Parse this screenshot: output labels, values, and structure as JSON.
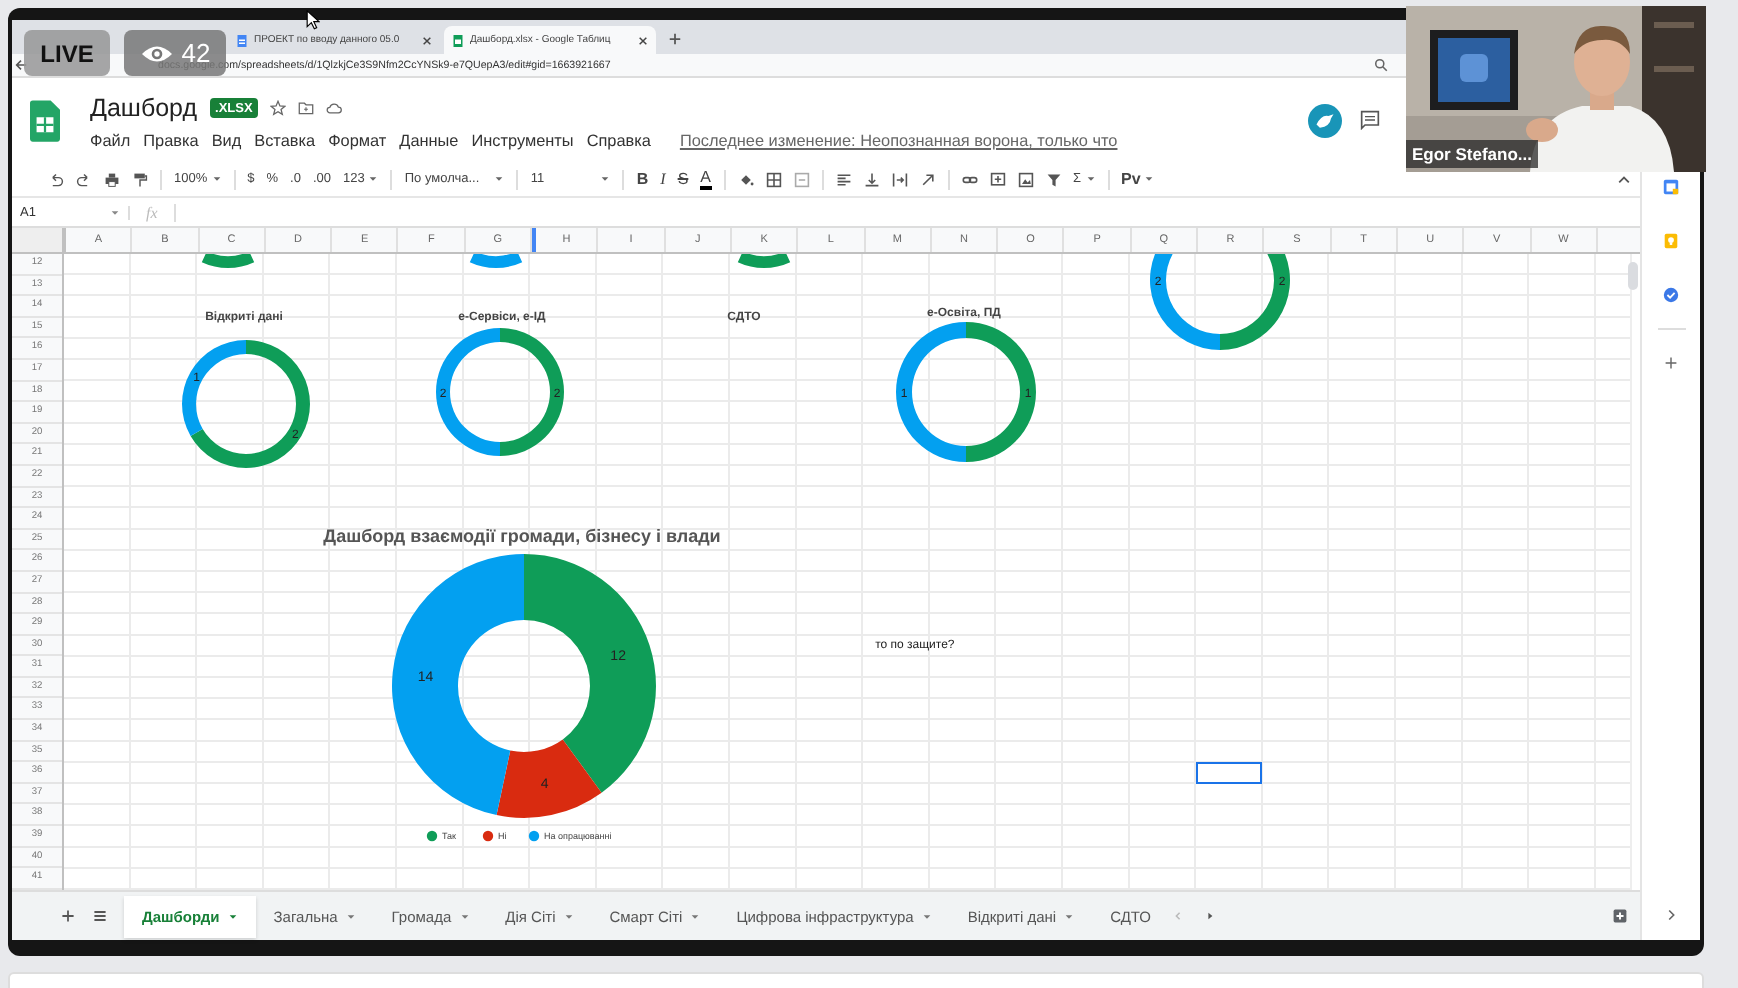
{
  "overlay": {
    "live": "LIVE",
    "viewers": "42"
  },
  "video": {
    "name": "Egor Stefano..."
  },
  "browser": {
    "tabs": [
      {
        "title": "ПРОЕКТ по вводу данного 05.0",
        "selected": false
      },
      {
        "title": "Дашборд.xlsx - Google Таблиц",
        "selected": true
      }
    ],
    "url": "docs.google.com/spreadsheets/d/1QlzkjCe3S9Nfm2CcYNSk9-e7QUepA3/edit#gid=1663921667"
  },
  "document": {
    "title": "Дашборд",
    "badge": ".XLSX",
    "menu": [
      "Файл",
      "Правка",
      "Вид",
      "Вставка",
      "Формат",
      "Данные",
      "Инструменты",
      "Справка"
    ],
    "last_edit": "Последнее изменение: Неопознанная ворона, только что"
  },
  "toolbar": {
    "zoom": "100%",
    "currency": "$",
    "percent": "%",
    "decrease_decimals": ".0",
    "increase_decimals": ".00",
    "number_format": "123",
    "font": "По умолча...",
    "font_size": "11",
    "bold": "B",
    "italic": "I",
    "strikethrough": "S",
    "text_color": "A",
    "functions": "Σ",
    "input_tools": "Рv"
  },
  "formula_bar": {
    "cell": "A1",
    "fx": "fx"
  },
  "columns": [
    "A",
    "B",
    "C",
    "D",
    "E",
    "F",
    "G",
    "H",
    "I",
    "J",
    "K",
    "L",
    "M",
    "N",
    "O",
    "P",
    "Q",
    "R",
    "S",
    "T",
    "U",
    "V",
    "W"
  ],
  "rows": [
    "12",
    "13",
    "14",
    "15",
    "16",
    "17",
    "18",
    "19",
    "20",
    "21",
    "22",
    "23",
    "24",
    "25",
    "26",
    "27",
    "28",
    "29",
    "30",
    "31",
    "32",
    "33",
    "34",
    "35",
    "36",
    "37",
    "38",
    "39",
    "40",
    "41"
  ],
  "cells": [
    {
      "text": "то по защите?"
    }
  ],
  "charts": [
    {
      "chart_data": {
        "type": "donut",
        "values": [
          2,
          2
        ],
        "data_labels": true
      }
    },
    {
      "chart_data": {
        "type": "donut",
        "title": "Відкриті дані",
        "values": [
          2,
          1
        ],
        "data_labels": true
      }
    },
    {
      "chart_data": {
        "type": "donut",
        "title": "е-Сервіси, е-ІД",
        "values": [
          2,
          2
        ],
        "data_labels": true
      }
    },
    {
      "title": "СДТО"
    },
    {
      "chart_data": {
        "type": "donut",
        "title": "е-Освіта, ПД",
        "values": [
          1,
          1
        ],
        "data_labels": true
      }
    },
    {
      "chart_data": {
        "type": "donut",
        "title": "Дашборд взаємодії громади, бізнесу і влади",
        "categories": [
          "Так",
          "Ні",
          "На опрацюванні"
        ],
        "values": [
          12,
          4,
          14
        ],
        "data_labels": true,
        "legend": "bottom"
      }
    }
  ],
  "sheet_tabs": [
    {
      "label": "Дашборди",
      "selected": true,
      "dropdown": true
    },
    {
      "label": "Загальна",
      "selected": false,
      "dropdown": true
    },
    {
      "label": "Громада",
      "selected": false,
      "dropdown": true
    },
    {
      "label": "Дія Сіті",
      "selected": false,
      "dropdown": true
    },
    {
      "label": "Смарт Сіті",
      "selected": false,
      "dropdown": true
    },
    {
      "label": "Цифрова інфраструктура",
      "selected": false,
      "dropdown": true
    },
    {
      "label": "Відкриті дані",
      "selected": false,
      "dropdown": true
    },
    {
      "label": "СДТО",
      "selected": false,
      "dropdown": false
    }
  ]
}
